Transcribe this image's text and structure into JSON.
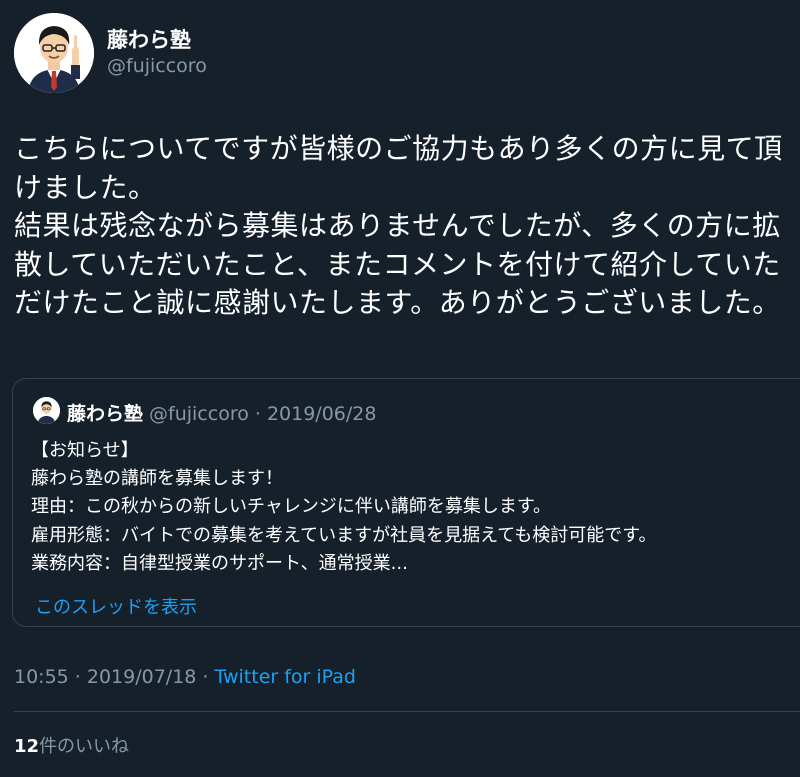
{
  "author": {
    "name": "藤わら塾",
    "handle": "@fujiccoro"
  },
  "tweet": {
    "lines": [
      "こちらについてですが皆様のご協力もあり多くの方に見て頂",
      "けました。",
      "結果は残念ながら募集はありませんでしたが、多くの方に拡",
      "散していただいたこと、またコメントを付けて紹介していた",
      "だけたこと誠に感謝いたします。ありがとうございました。"
    ]
  },
  "quoted": {
    "name": "藤わら塾",
    "meta": "@fujiccoro · 2019/06/28",
    "lines": [
      "【お知らせ】",
      "藤わら塾の講師を募集します！",
      "理由：この秋からの新しいチャレンジに伴い講師を募集します。",
      "雇用形態：バイトでの募集を考えていますが社員を見据えても検討可能です。",
      "業務内容：自律型授業のサポート、通常授業..."
    ],
    "show_thread": "このスレッドを表示"
  },
  "meta": {
    "time_date": "10:55 · 2019/07/18 · ",
    "source": "Twitter for iPad"
  },
  "likes": {
    "count": "12",
    "label": "件のいいね"
  },
  "colors": {
    "background": "#15202b",
    "text": "#ffffff",
    "secondary": "#8899a6",
    "link": "#1da1f2",
    "border": "#38444d"
  }
}
